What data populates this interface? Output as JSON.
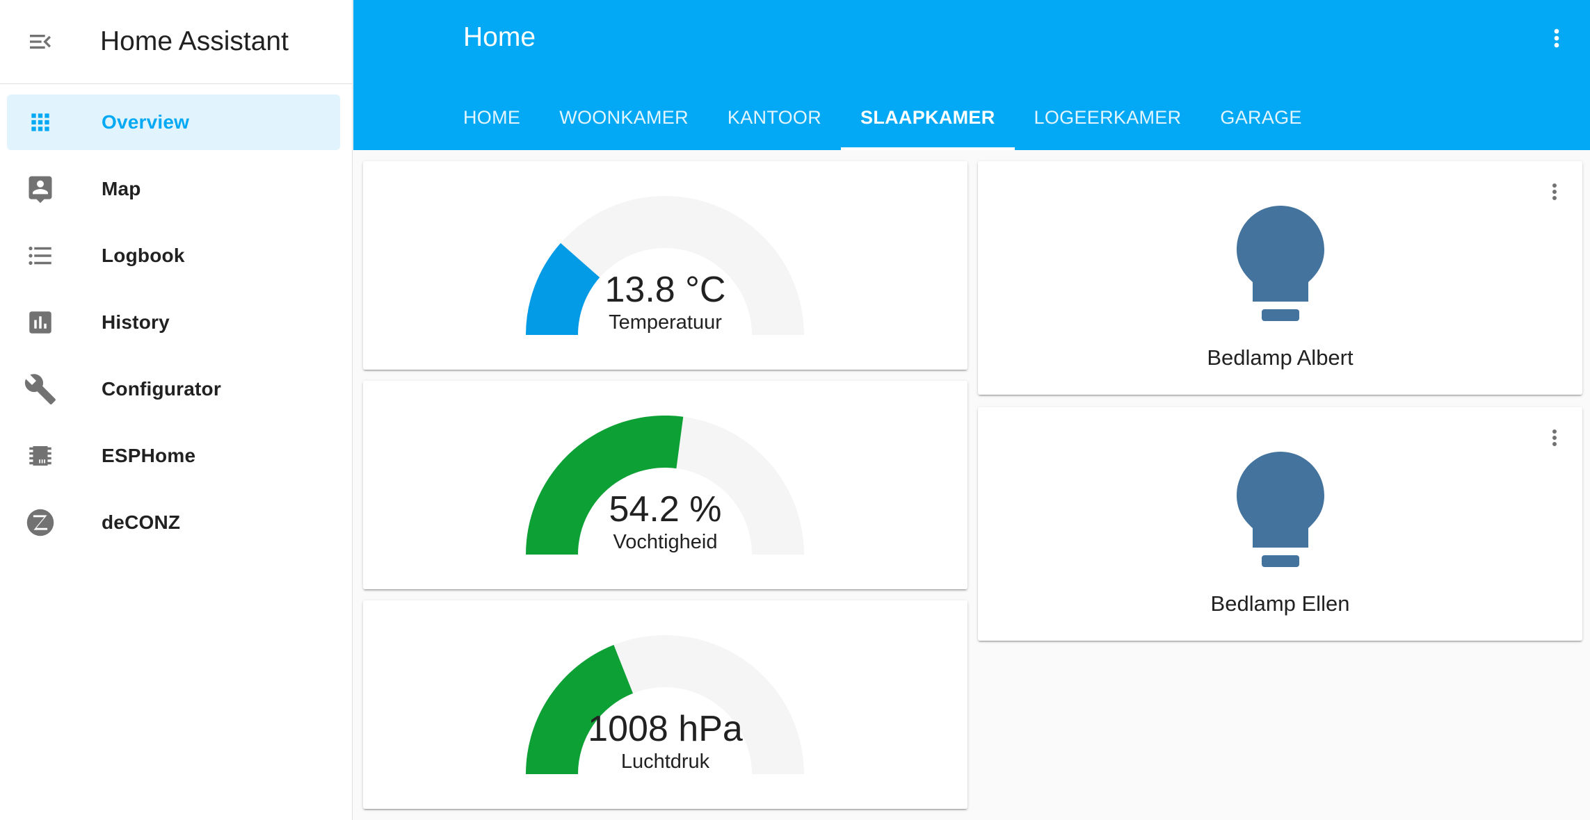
{
  "app": {
    "title": "Home Assistant"
  },
  "sidebar": {
    "items": [
      {
        "label": "Overview",
        "icon": "grid-icon",
        "active": true
      },
      {
        "label": "Map",
        "icon": "account-box-icon"
      },
      {
        "label": "Logbook",
        "icon": "format-list-bulleted-icon"
      },
      {
        "label": "History",
        "icon": "chart-box-icon"
      },
      {
        "label": "Configurator",
        "icon": "wrench-icon"
      },
      {
        "label": "ESPHome",
        "icon": "chip-icon"
      },
      {
        "label": "deCONZ",
        "icon": "zigbee-icon"
      }
    ]
  },
  "header": {
    "title": "Home",
    "tabs": [
      {
        "label": "HOME"
      },
      {
        "label": "WOONKAMER"
      },
      {
        "label": "KANTOOR"
      },
      {
        "label": "SLAAPKAMER",
        "active": true
      },
      {
        "label": "LOGEERKAMER"
      },
      {
        "label": "GARAGE"
      }
    ]
  },
  "gauges": [
    {
      "value": "13.8 °C",
      "name": "Temperatuur",
      "fraction": 0.23,
      "color": "#039be5"
    },
    {
      "value": "54.2 %",
      "name": "Vochtigheid",
      "fraction": 0.542,
      "color": "#0da035"
    },
    {
      "value": "1008 hPa",
      "name": "Luchtdruk",
      "fraction": 0.38,
      "color": "#0da035"
    }
  ],
  "lights": [
    {
      "name": "Bedlamp Albert",
      "color": "#44739e"
    },
    {
      "name": "Bedlamp Ellen",
      "color": "#44739e"
    }
  ],
  "colors": {
    "primary": "#03a9f4",
    "gauge_track": "#f5f5f5",
    "sidebar_icon": "#727272"
  }
}
